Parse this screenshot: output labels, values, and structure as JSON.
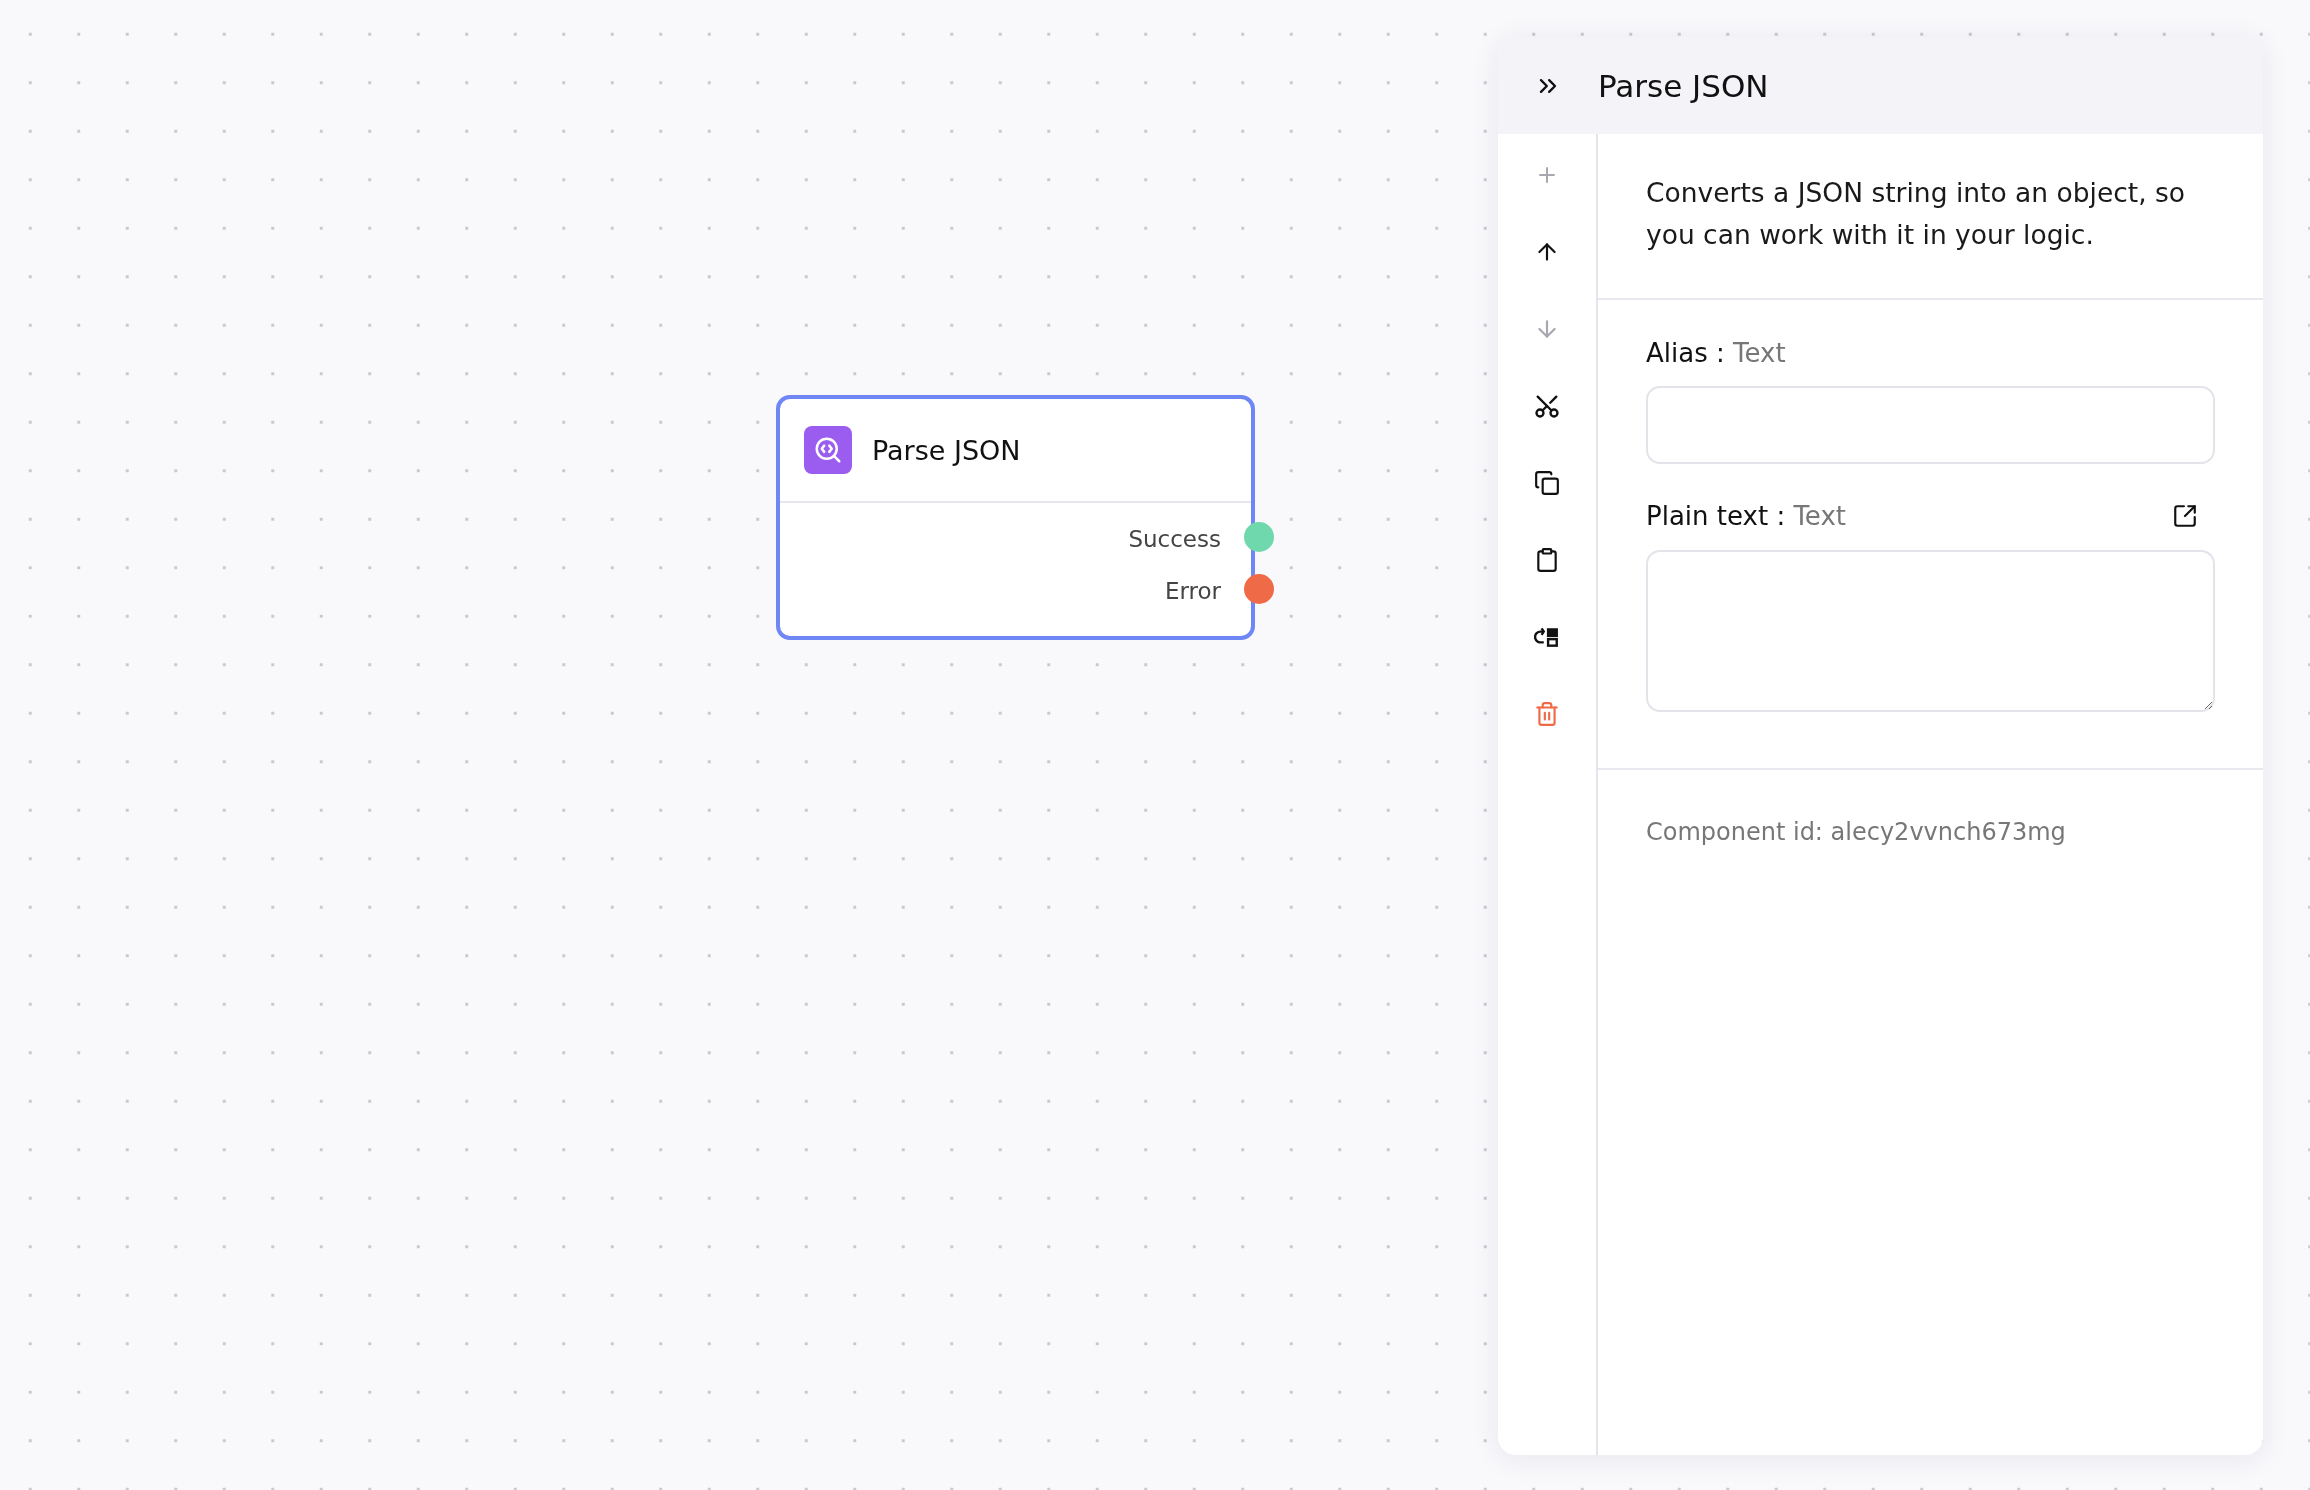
{
  "node": {
    "title": "Parse JSON",
    "selected": true,
    "ports": [
      {
        "label": "Success",
        "color": "#6fd8ad"
      },
      {
        "label": "Error",
        "color": "#ef6b48"
      }
    ]
  },
  "panel": {
    "title": "Parse JSON",
    "toolbar": [
      {
        "kind": "add",
        "disabled": true
      },
      {
        "kind": "move-up",
        "disabled": false
      },
      {
        "kind": "move-down",
        "disabled": true
      },
      {
        "kind": "cut",
        "disabled": false
      },
      {
        "kind": "copy",
        "disabled": false
      },
      {
        "kind": "paste",
        "disabled": false
      },
      {
        "kind": "replace",
        "disabled": false
      },
      {
        "kind": "delete",
        "disabled": false
      }
    ],
    "description": "Converts a JSON string into an object, so you can work with it in your logic.",
    "fields": [
      {
        "kind": "input",
        "label": "Alias :",
        "type": "Text",
        "expandable": false
      },
      {
        "kind": "textarea",
        "label": "Plain text :",
        "type": "Text",
        "expandable": true
      }
    ],
    "component_id": "Component id: alecy2vvnch673mg"
  }
}
